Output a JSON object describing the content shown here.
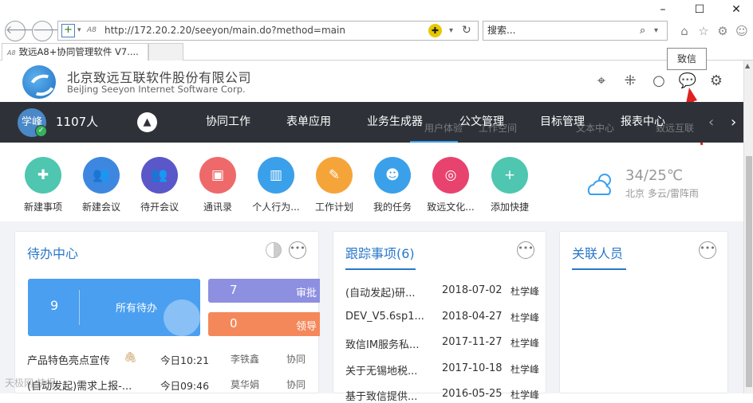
{
  "browser": {
    "minimize": "–",
    "maximize": "☐",
    "close": "✕",
    "address_url": "http://172.20.2.20/seeyon/main.do?method=main",
    "address_prefix": "A8",
    "search_text": "搜索...",
    "tab_title": "致远A8+协同管理软件 V7...."
  },
  "tooltip": "致信",
  "company": {
    "name_cn": "北京致远互联软件股份有限公司",
    "name_en": "BeiJing Seeyon Internet Software Corp."
  },
  "user": {
    "avatar_text": "学峰",
    "count_label": "1107人"
  },
  "nav": {
    "items": [
      "协同工作",
      "表单应用",
      "业务生成器",
      "公文管理",
      "目标管理",
      "报表中心"
    ],
    "ghost_items": [
      "用户体验",
      "工作空间",
      "文本中心",
      "致远互联"
    ]
  },
  "quick": [
    {
      "label": "新建事项",
      "color": "#4ec6b0",
      "icon": "new-item-icon",
      "glyph": "✚"
    },
    {
      "label": "新建会议",
      "color": "#3d87e0",
      "icon": "meeting-icon",
      "glyph": "👥"
    },
    {
      "label": "待开会议",
      "color": "#5a57c9",
      "icon": "pending-meeting-icon",
      "glyph": "👥"
    },
    {
      "label": "通讯录",
      "color": "#ee6a6a",
      "icon": "contacts-icon",
      "glyph": "▣"
    },
    {
      "label": "个人行为...",
      "color": "#3aa0ea",
      "icon": "behavior-chart-icon",
      "glyph": "▥"
    },
    {
      "label": "工作计划",
      "color": "#f5a43a",
      "icon": "plan-icon",
      "glyph": "✎"
    },
    {
      "label": "我的任务",
      "color": "#3aa0ea",
      "icon": "task-icon",
      "glyph": "☻"
    },
    {
      "label": "致远文化...",
      "color": "#e8436e",
      "icon": "culture-icon",
      "glyph": "◎"
    },
    {
      "label": "添加快捷",
      "color": "#4ec6b0",
      "icon": "add-shortcut-icon",
      "glyph": "+"
    }
  ],
  "weather": {
    "temp": "34/25℃",
    "desc": "北京 多云/雷阵雨"
  },
  "todo": {
    "title": "待办中心",
    "big_count": "9",
    "big_label": "所有待办",
    "chips": [
      {
        "count": "7",
        "label": "审批",
        "color": "#8d8fe0"
      },
      {
        "count": "0",
        "label": "领导",
        "color": "#f4885a"
      }
    ],
    "rows": [
      {
        "title": "产品特色亮点宣传",
        "time": "今日10:21",
        "person": "李铁鑫",
        "type": "协同"
      },
      {
        "title": "(自动发起)需求上报-...",
        "time": "今日09:46",
        "person": "莫华娟",
        "type": "协同"
      }
    ]
  },
  "track": {
    "title": "跟踪事项(6)",
    "rows": [
      {
        "title": "(自动发起)研...",
        "date": "2018-07-02",
        "person": "杜学峰"
      },
      {
        "title": "DEV_V5.6sp1...",
        "date": "2018-04-27",
        "person": "杜学峰"
      },
      {
        "title": "致信IM服务私...",
        "date": "2017-11-27",
        "person": "杜学峰"
      },
      {
        "title": "关于无锡地税...",
        "date": "2017-10-18",
        "person": "杜学峰"
      },
      {
        "title": "基于致信提供...",
        "date": "2016-05-25",
        "person": "杜学峰"
      }
    ]
  },
  "related": {
    "title": "关联人员"
  },
  "watermark": "天极网·快报"
}
